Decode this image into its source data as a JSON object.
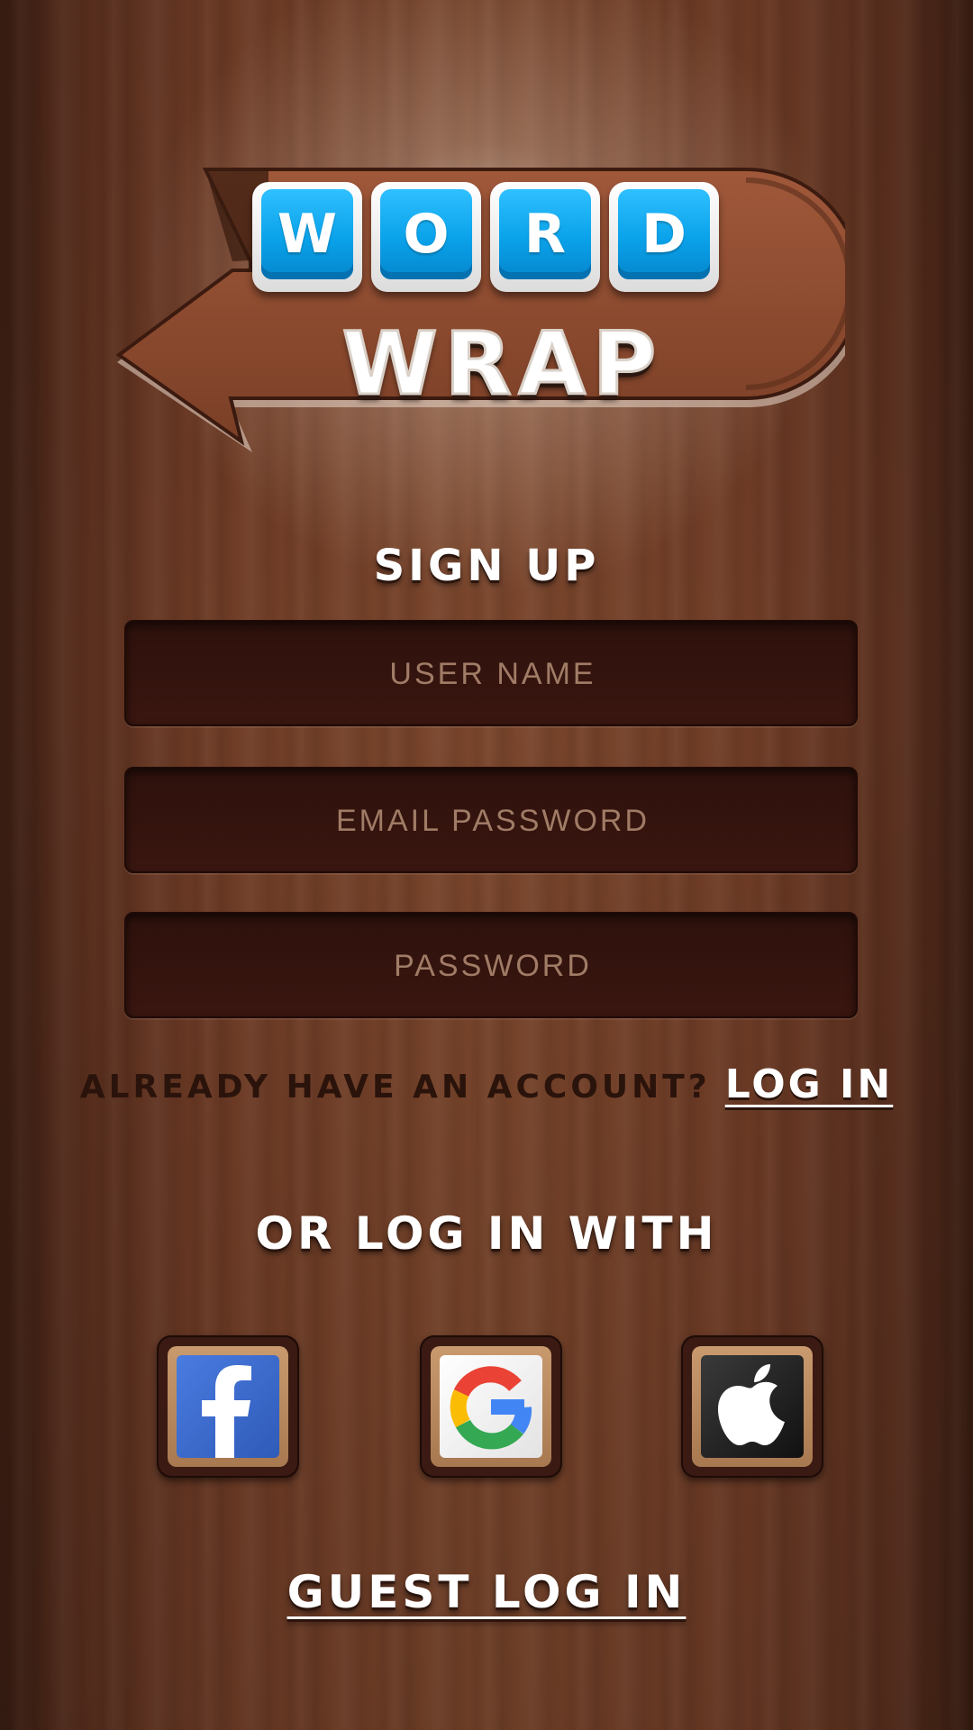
{
  "logo": {
    "tiles": [
      "W",
      "O",
      "R",
      "D"
    ],
    "word": "WRAP"
  },
  "signup": {
    "title": "SIGN UP",
    "username_placeholder": "USER NAME",
    "email_placeholder": "EMAIL PASSWORD",
    "password_placeholder": "PASSWORD"
  },
  "account": {
    "prompt": "ALREADY HAVE AN ACCOUNT?",
    "login_label": "LOG IN"
  },
  "social": {
    "title": "OR LOG IN WITH",
    "buttons": [
      {
        "icon": "facebook-icon",
        "color": "#3b67c9"
      },
      {
        "icon": "google-icon",
        "color": "#ffffff"
      },
      {
        "icon": "apple-icon",
        "color": "#222222"
      }
    ]
  },
  "guest": {
    "label": "GUEST LOG IN"
  },
  "colors": {
    "tile_blue": "#0aa2ea",
    "wood": "#7b462c",
    "field_dark": "#2e110c"
  }
}
